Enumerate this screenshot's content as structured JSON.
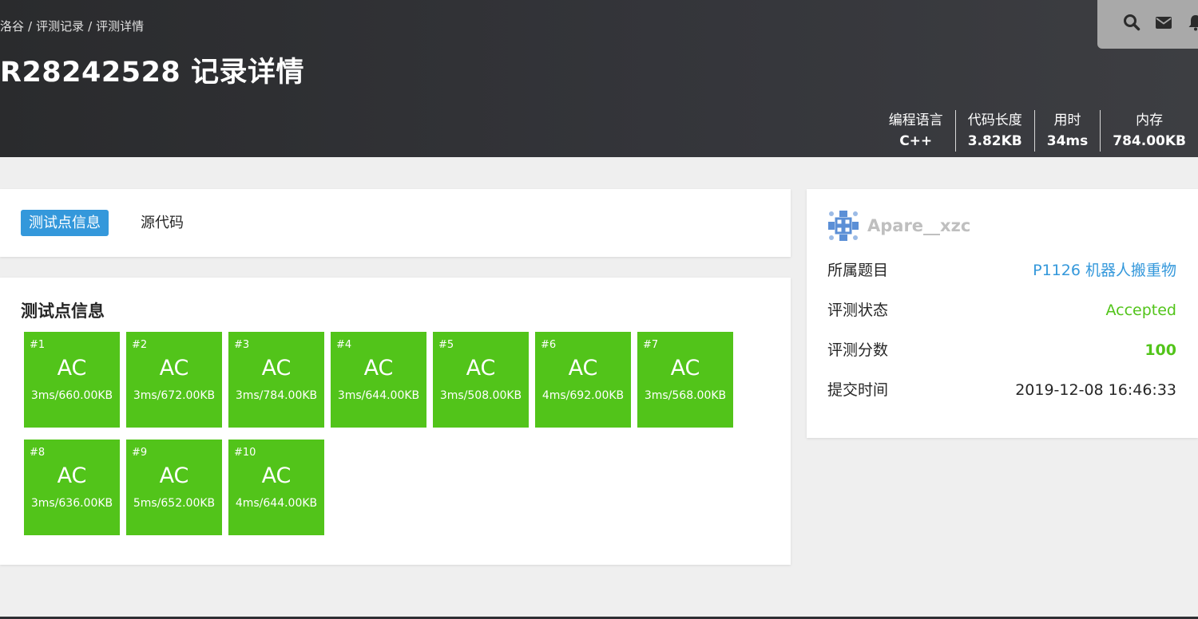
{
  "breadcrumb": [
    "洛谷",
    "评测记录",
    "评测详情"
  ],
  "breadcrumb_sep": "/",
  "title": "R28242528 记录详情",
  "header_icons": [
    "search-icon",
    "mail-icon",
    "bell-icon"
  ],
  "stats": [
    {
      "label": "编程语言",
      "value": "C++"
    },
    {
      "label": "代码长度",
      "value": "3.82KB"
    },
    {
      "label": "用时",
      "value": "34ms"
    },
    {
      "label": "内存",
      "value": "784.00KB"
    }
  ],
  "tabs": [
    {
      "label": "测试点信息",
      "active": true
    },
    {
      "label": "源代码",
      "active": false
    }
  ],
  "tests_title": "测试点信息",
  "testcases": [
    {
      "id": "#1",
      "status": "AC",
      "detail": "3ms/660.00KB"
    },
    {
      "id": "#2",
      "status": "AC",
      "detail": "3ms/672.00KB"
    },
    {
      "id": "#3",
      "status": "AC",
      "detail": "3ms/784.00KB"
    },
    {
      "id": "#4",
      "status": "AC",
      "detail": "3ms/644.00KB"
    },
    {
      "id": "#5",
      "status": "AC",
      "detail": "3ms/508.00KB"
    },
    {
      "id": "#6",
      "status": "AC",
      "detail": "4ms/692.00KB"
    },
    {
      "id": "#7",
      "status": "AC",
      "detail": "3ms/568.00KB"
    },
    {
      "id": "#8",
      "status": "AC",
      "detail": "3ms/636.00KB"
    },
    {
      "id": "#9",
      "status": "AC",
      "detail": "5ms/652.00KB"
    },
    {
      "id": "#10",
      "status": "AC",
      "detail": "4ms/644.00KB"
    }
  ],
  "user": {
    "name": "Apare__xzc",
    "avatar_icon": "identicon-avatar"
  },
  "info": {
    "problem_label": "所属题目",
    "problem_value": "P1126 机器人搬重物",
    "status_label": "评测状态",
    "status_value": "Accepted",
    "score_label": "评测分数",
    "score_value": "100",
    "time_label": "提交时间",
    "time_value": "2019-12-08 16:46:33"
  },
  "colors": {
    "accent": "#3498db",
    "ac_green": "#52c41a",
    "header_bg": "#2e2f33",
    "username_gray": "#bfbfbf"
  }
}
